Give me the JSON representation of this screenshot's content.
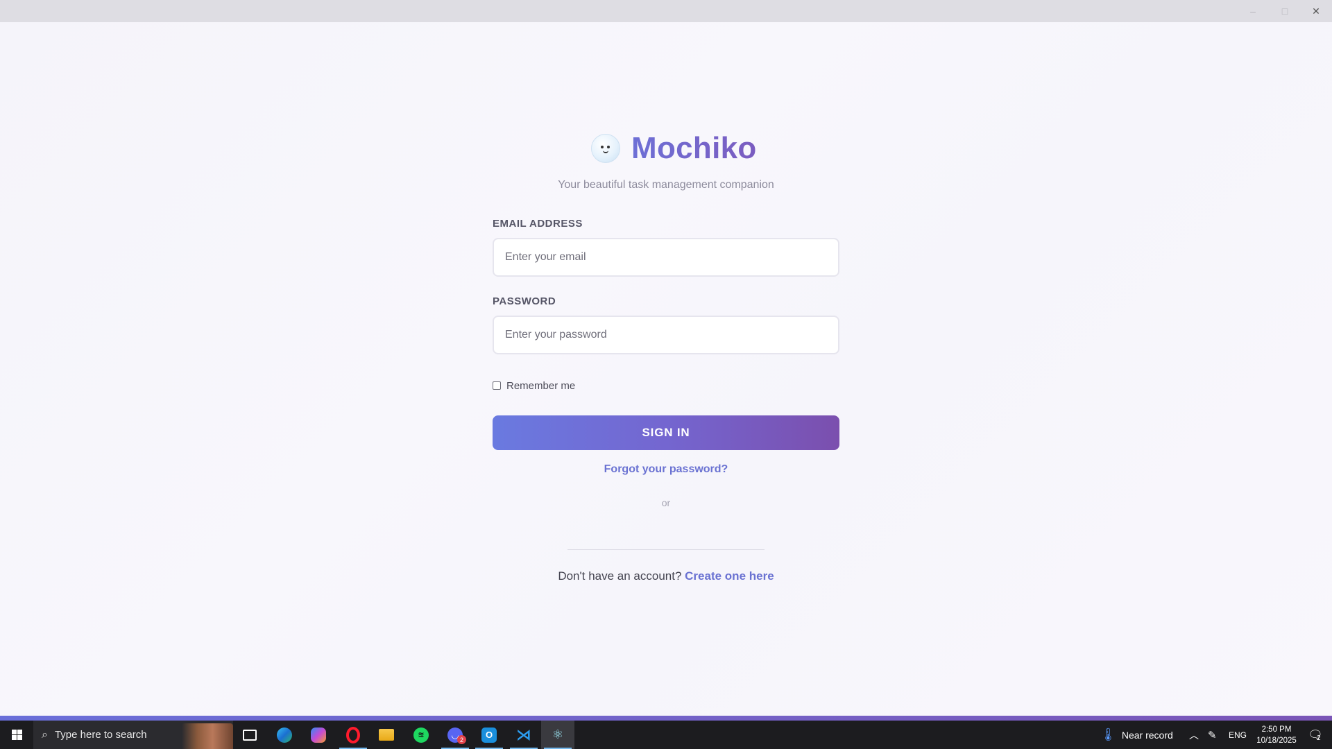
{
  "window": {
    "minimize_glyph": "–",
    "maximize_glyph": "□",
    "close_glyph": "✕"
  },
  "brand": {
    "name": "Mochiko",
    "tagline": "Your beautiful task management companion",
    "logo_icon": "smiling-mochi-face-icon"
  },
  "form": {
    "email_label": "EMAIL ADDRESS",
    "email_placeholder": "Enter your email",
    "email_value": "",
    "password_label": "PASSWORD",
    "password_placeholder": "Enter your password",
    "password_value": "",
    "remember_label": "Remember me",
    "remember_checked": false,
    "signin_label": "SIGN IN",
    "forgot_label": "Forgot your password?",
    "or_label": "or",
    "signup_prompt": "Don't have an account?",
    "signup_link": "Create one here"
  },
  "colors": {
    "accent_start": "#6a7ae0",
    "accent_end": "#7b4fae",
    "link": "#6a72d2",
    "background": "#f7f6fb"
  },
  "taskbar": {
    "search_placeholder": "Type here to search",
    "apps": [
      {
        "name": "task-view",
        "icon": "task-view-icon"
      },
      {
        "name": "edge",
        "icon": "edge-icon"
      },
      {
        "name": "copilot",
        "icon": "copilot-icon"
      },
      {
        "name": "opera",
        "icon": "opera-icon"
      },
      {
        "name": "file-explorer",
        "icon": "folder-icon"
      },
      {
        "name": "spotify",
        "icon": "spotify-icon"
      },
      {
        "name": "discord",
        "icon": "discord-icon",
        "badge": "2"
      },
      {
        "name": "outlook",
        "icon": "outlook-icon"
      },
      {
        "name": "vscode",
        "icon": "vscode-icon"
      },
      {
        "name": "electron-app",
        "icon": "electron-icon"
      }
    ],
    "weather_text": "Near record",
    "language": "ENG",
    "time": "2:50 PM",
    "date": "10/18/2025",
    "notification_count": "2"
  }
}
